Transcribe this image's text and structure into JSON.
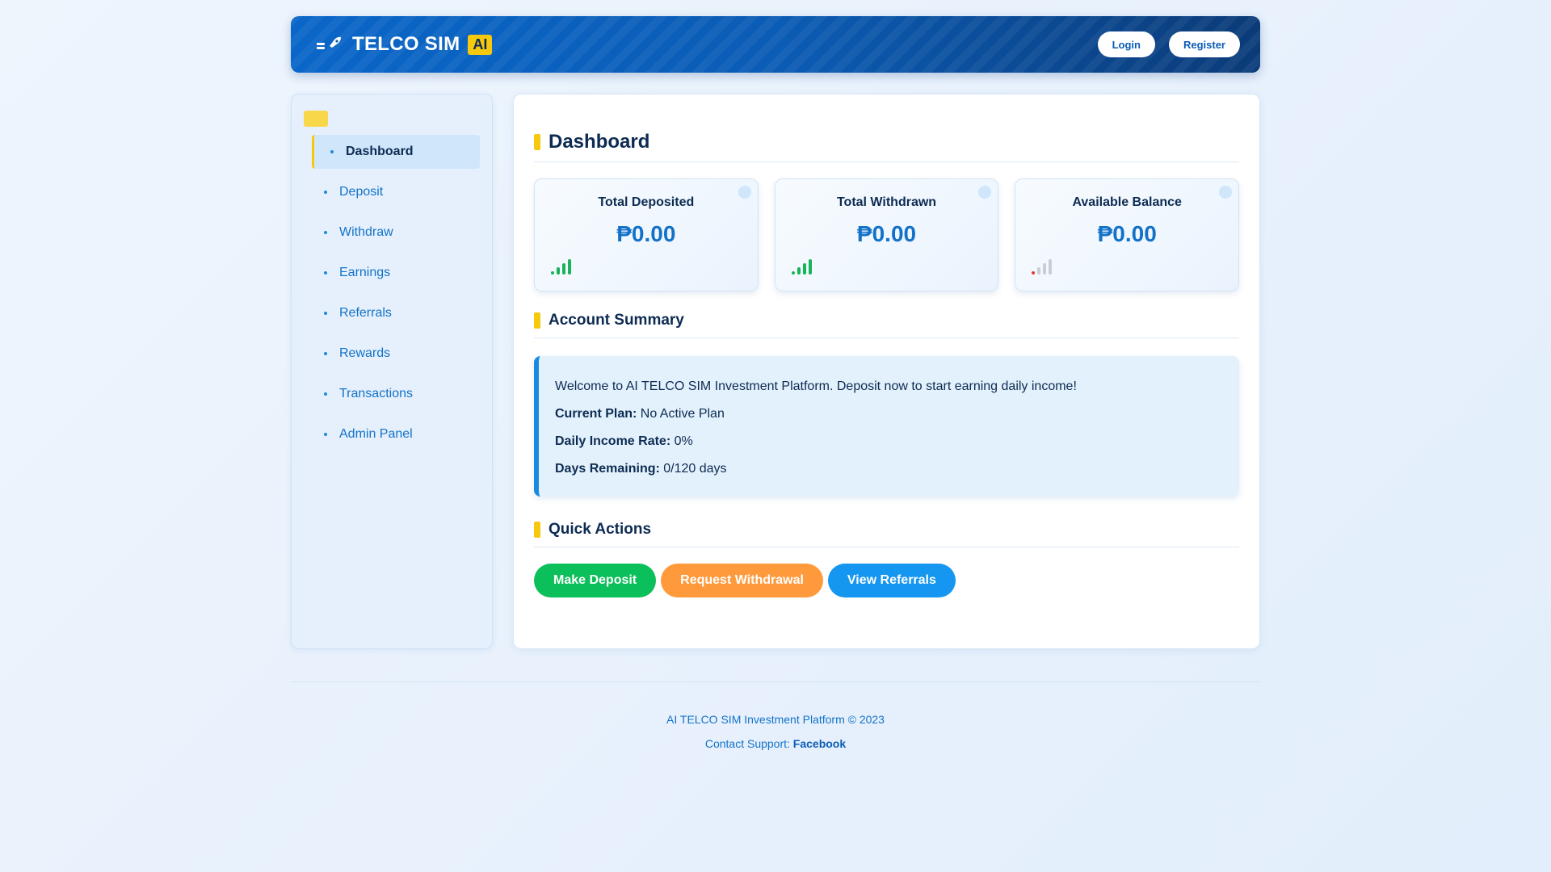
{
  "header": {
    "brand_title": "TELCO SIM",
    "brand_badge": "AI",
    "login_label": "Login",
    "register_label": "Register"
  },
  "sidebar": {
    "items": [
      {
        "label": "Dashboard",
        "active": true
      },
      {
        "label": "Deposit"
      },
      {
        "label": "Withdraw"
      },
      {
        "label": "Earnings"
      },
      {
        "label": "Referrals"
      },
      {
        "label": "Rewards"
      },
      {
        "label": "Transactions"
      },
      {
        "label": "Admin Panel"
      }
    ]
  },
  "main": {
    "title": "Dashboard",
    "cards": [
      {
        "label": "Total Deposited",
        "value": "₱0.00",
        "signal_color": "#19b35a",
        "signal_level": 4
      },
      {
        "label": "Total Withdrawn",
        "value": "₱0.00",
        "signal_color": "#19b35a",
        "signal_level": 4
      },
      {
        "label": "Available Balance",
        "value": "₱0.00",
        "signal_color": "#e53935",
        "signal_level": 1
      }
    ],
    "summary_title": "Account Summary",
    "summary": {
      "welcome": "Welcome to AI TELCO SIM Investment Platform. Deposit now to start earning daily income!",
      "plan_label": "Current Plan:",
      "plan_value": " No Active Plan",
      "rate_label": "Daily Income Rate:",
      "rate_value": " 0%",
      "days_label": "Days Remaining:",
      "days_value": " 0/120 days"
    },
    "actions_title": "Quick Actions",
    "actions": [
      {
        "label": "Make Deposit",
        "color": "#0bbf5a"
      },
      {
        "label": "Request Withdrawal",
        "color": "#ff9a3c"
      },
      {
        "label": "View Referrals",
        "color": "#1596f0"
      }
    ]
  },
  "footer": {
    "copyright": "AI TELCO SIM Investment Platform © 2023",
    "contact_prefix": "Contact Support: ",
    "contact_link": "Facebook"
  }
}
